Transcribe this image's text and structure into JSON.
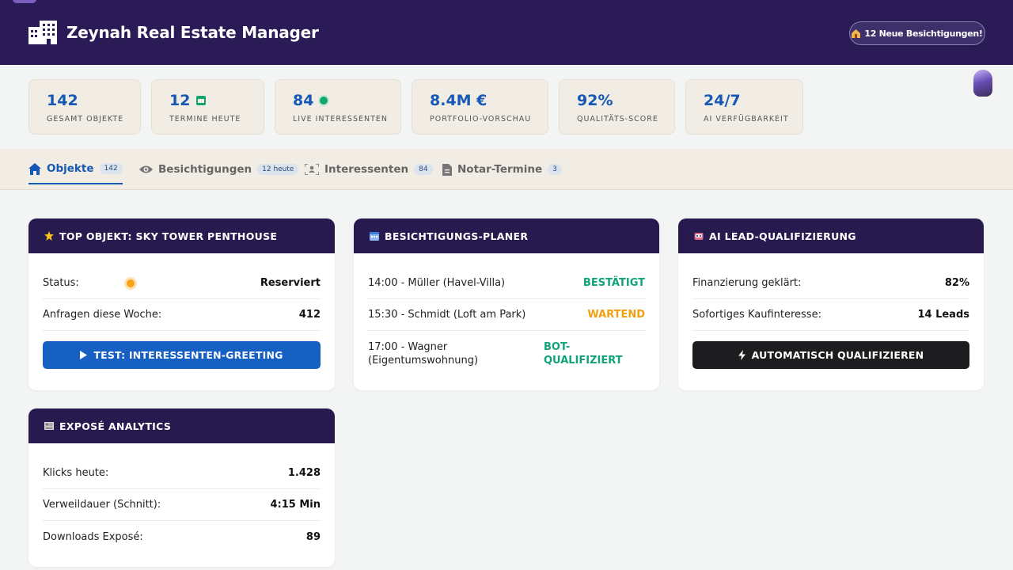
{
  "header": {
    "title": "Zeynah Real Estate Manager",
    "logo_icon": "building-icon",
    "notification_label": "12 Neue Besichtigungen!",
    "notification_icon": "house-icon"
  },
  "stats": [
    {
      "value": "142",
      "label": "GESAMT OBJEKTE"
    },
    {
      "value": "12",
      "label": "TERMINE HEUTE",
      "icon": "calendar-icon"
    },
    {
      "value": "84",
      "label": "LIVE INTERESSENTEN",
      "icon": "live-dot-icon"
    },
    {
      "value": "8.4M €",
      "label": "PORTFOLIO-VORSCHAU"
    },
    {
      "value": "92%",
      "label": "QUALITÄTS-SCORE"
    },
    {
      "value": "24/7",
      "label": "AI VERFÜGBARKEIT"
    }
  ],
  "tabs": [
    {
      "label": "Objekte",
      "badge": "142",
      "icon": "home-icon",
      "active": true
    },
    {
      "label": "Besichtigungen",
      "badge": "12 heute",
      "icon": "eye-icon"
    },
    {
      "label": "Interessenten",
      "badge": "84",
      "icon": "user-scan-icon"
    },
    {
      "label": "Notar-Termine",
      "badge": "3",
      "icon": "document-icon"
    }
  ],
  "cards": {
    "top_object": {
      "title": "TOP OBJEKT: SKY TOWER PENTHOUSE",
      "icon": "star-icon",
      "status_label": "Status:",
      "status_value": "Reserviert",
      "inquiries_label": "Anfragen diese Woche:",
      "inquiries_value": "412",
      "button_label": "TEST: INTERESSENTEN-GREETING"
    },
    "viewing_planner": {
      "title": "BESICHTIGUNGS-PLANER",
      "icon": "calendar-icon",
      "items": [
        {
          "text": "14:00 - Müller (Havel-Villa)",
          "status": "BESTÄTIGT"
        },
        {
          "text": "15:30 - Schmidt (Loft am Park)",
          "status": "WARTEND"
        },
        {
          "text": "17:00 - Wagner (Eigentumswohnung)",
          "status": "BOT-QUALIFIZIERT"
        }
      ]
    },
    "lead_qualification": {
      "title": "AI LEAD-QUALIFIZIERUNG",
      "icon": "robot-icon",
      "financing_label": "Finanzierung geklärt:",
      "financing_value": "82%",
      "interest_label": "Sofortiges Kaufinteresse:",
      "interest_value": "14 Leads",
      "button_label": "AUTOMATISCH QUALIFIZIEREN"
    },
    "expose_analytics": {
      "title": "EXPOSÉ ANALYTICS",
      "icon": "newspaper-icon",
      "rows": [
        {
          "label": "Klicks heute:",
          "value": "1.428"
        },
        {
          "label": "Verweildauer (Schnitt):",
          "value": "4:15 Min"
        },
        {
          "label": "Downloads Exposé:",
          "value": "89"
        }
      ]
    }
  },
  "colors": {
    "header_bg": "#2a1b56",
    "accent_blue": "#1658b5",
    "status_green": "#10a37a",
    "status_orange": "#f2a012",
    "card_head": "#261a4f"
  }
}
